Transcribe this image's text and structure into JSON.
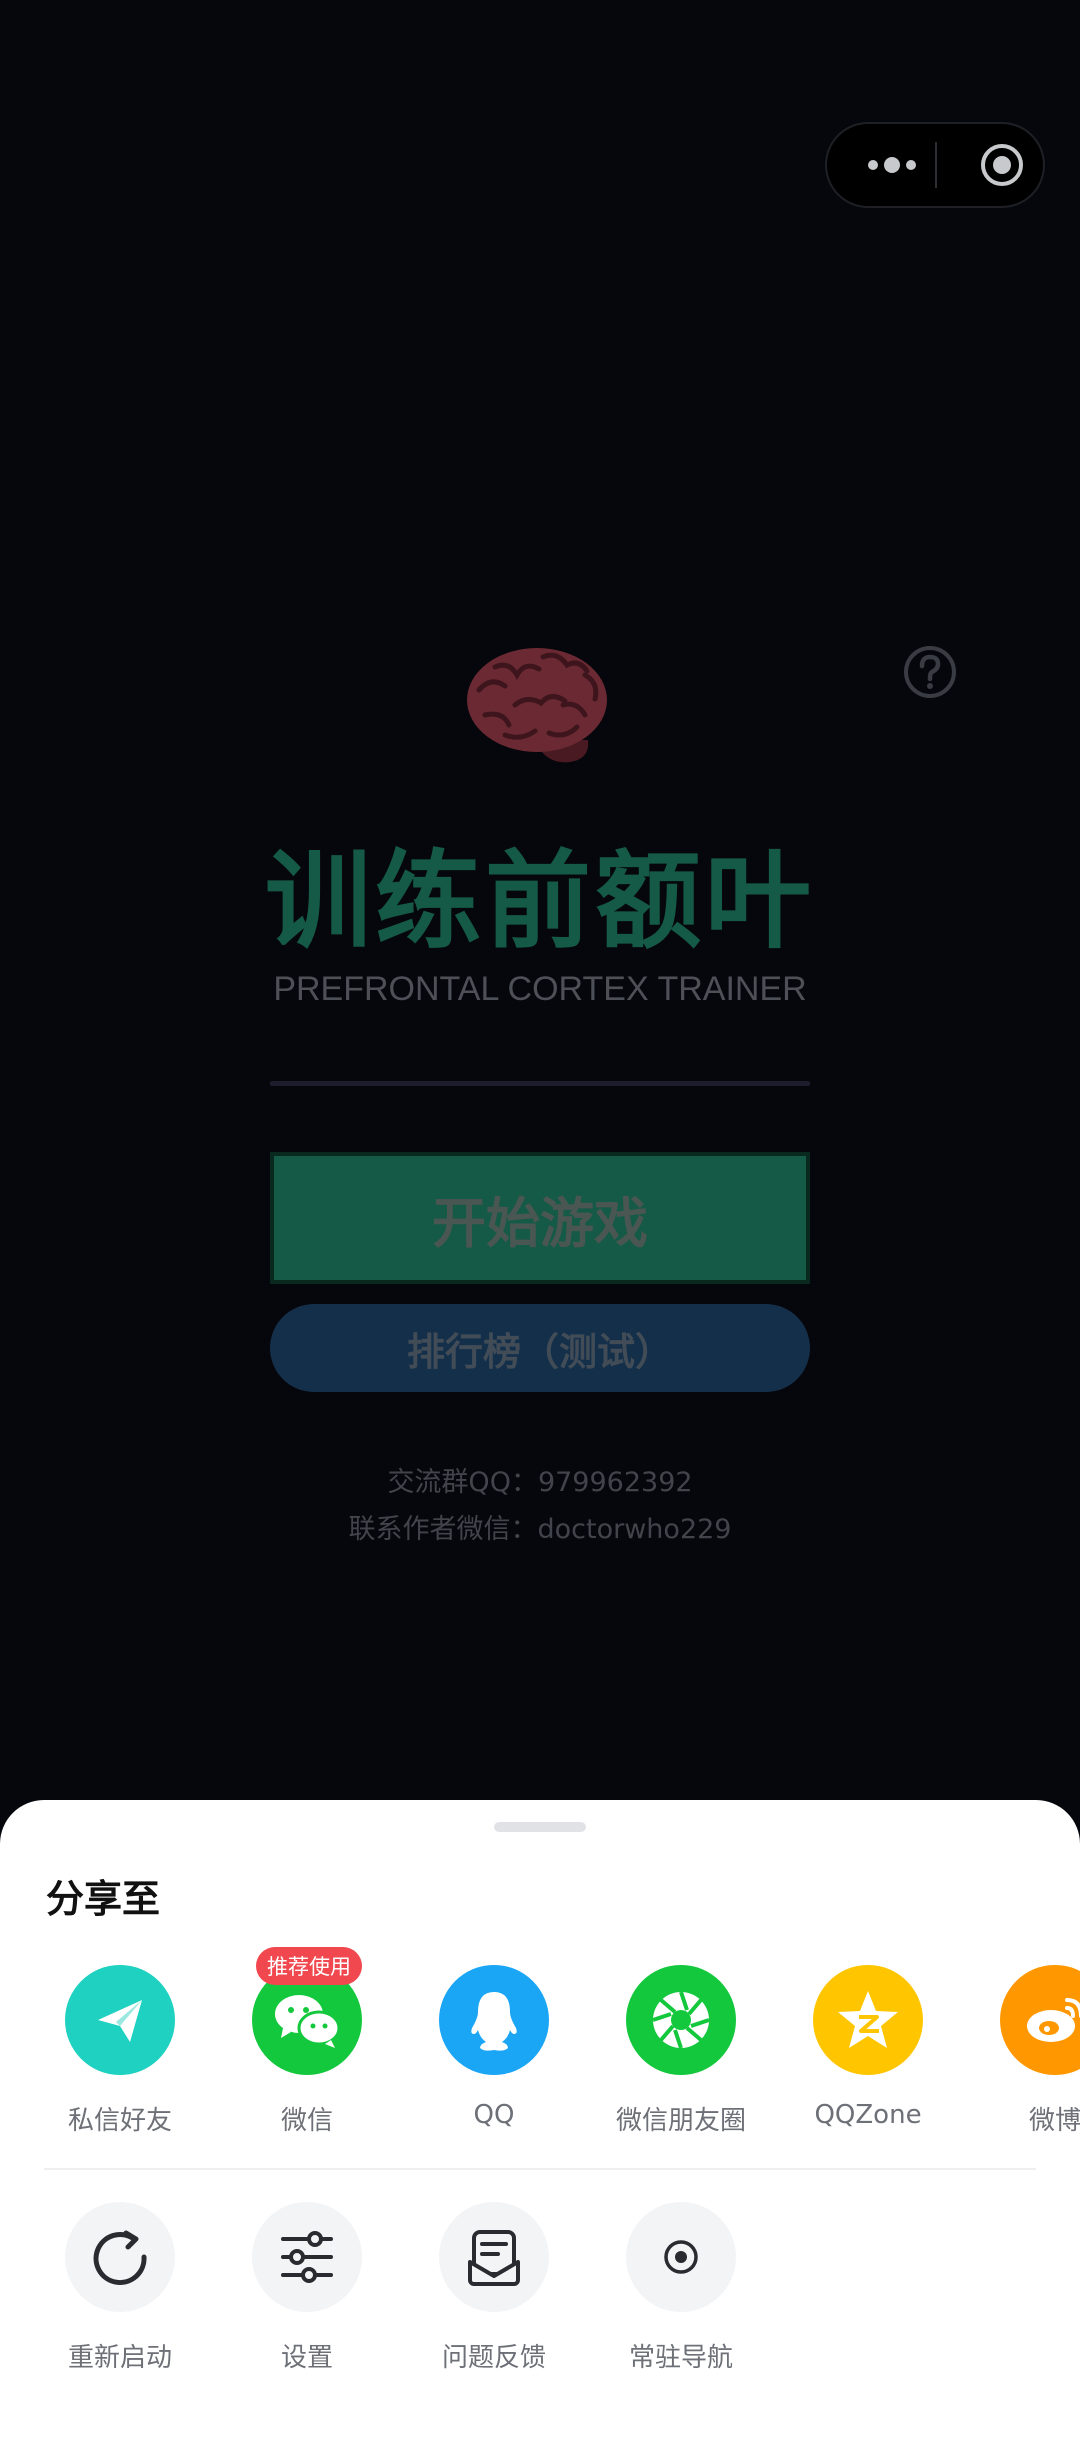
{
  "app": {
    "title": "训练前额叶",
    "subtitle": "PREFRONTAL CORTEX TRAINER",
    "start_label": "开始游戏",
    "rank_label": "排行榜（测试）",
    "contact_qq": "交流群QQ：979962392",
    "contact_wechat": "联系作者微信：doctorwho229",
    "brand_color": "#155a46",
    "rank_color": "#142f4a"
  },
  "sheet": {
    "title": "分享至",
    "badge": "推荐使用",
    "share_targets": [
      {
        "label": "私信好友",
        "icon": "paper-plane-icon",
        "color": "#1ed1c1"
      },
      {
        "label": "微信",
        "icon": "wechat-icon",
        "color": "#13c83c"
      },
      {
        "label": "QQ",
        "icon": "qq-penguin-icon",
        "color": "#1aa5f5"
      },
      {
        "label": "微信朋友圈",
        "icon": "moments-shutter-icon",
        "color": "#13c83c"
      },
      {
        "label": "QQZone",
        "icon": "qzone-star-icon",
        "color": "#ffc600"
      },
      {
        "label": "微博",
        "icon": "weibo-icon",
        "color": "#ff9800"
      }
    ],
    "actions": [
      {
        "label": "重新启动",
        "icon": "restart-icon"
      },
      {
        "label": "设置",
        "icon": "settings-sliders-icon"
      },
      {
        "label": "问题反馈",
        "icon": "feedback-icon"
      },
      {
        "label": "常驻导航",
        "icon": "pin-nav-icon"
      }
    ]
  }
}
